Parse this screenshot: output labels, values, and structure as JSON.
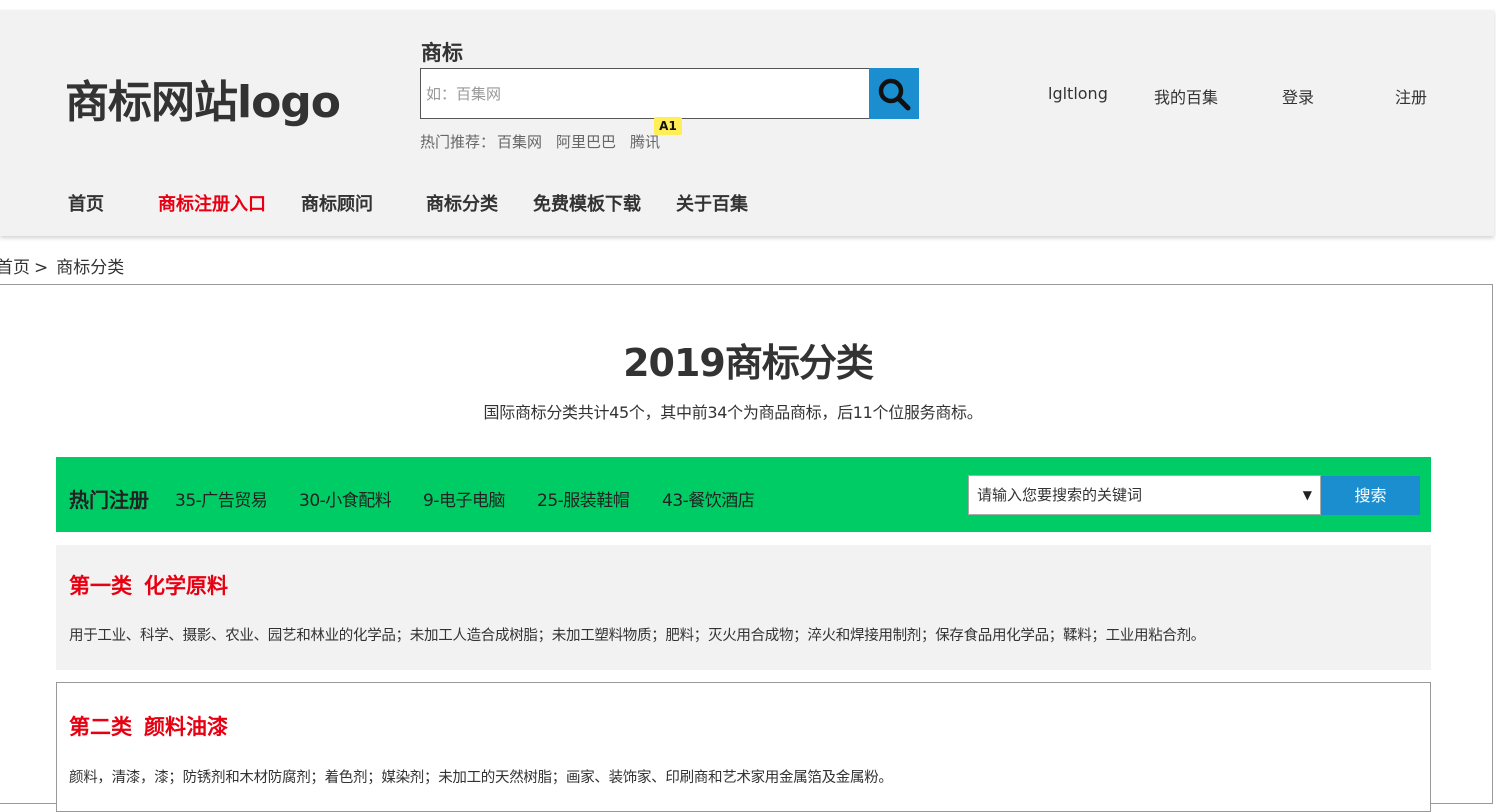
{
  "header": {
    "logo": "商标网站logo",
    "search_label": "商标",
    "search_placeholder": "如：百集网",
    "hot_prefix": "热门推荐：",
    "hot_items": [
      "百集网",
      "阿里巴巴",
      "腾讯"
    ],
    "badge": "A1",
    "user_links": [
      "lgltlong",
      "我的百集",
      "登录",
      "注册"
    ],
    "nav": [
      "首页",
      "商标注册入口",
      "商标顾问",
      "商标分类",
      "免费模板下载",
      "关于百集"
    ],
    "nav_active_index": 1
  },
  "breadcrumb": {
    "home": "首页",
    "separator": ">",
    "current": "商标分类"
  },
  "main": {
    "title": "2019商标分类",
    "subtitle": "国际商标分类共计45个，其中前34个为商品商标，后11个位服务商标。",
    "hot_bar": {
      "title": "热门注册",
      "items": [
        "35-广告贸易",
        "30-小食配料",
        "9-电子电脑",
        "25-服装鞋帽",
        "43-餐饮酒店"
      ],
      "select_value": "请输入您要搜索的关键词",
      "search_button": "搜索"
    },
    "categories": [
      {
        "num": "第一类",
        "name": "化学原料",
        "desc": "用于工业、科学、摄影、农业、园艺和林业的化学品；未加工人造合成树脂；未加工塑料物质；肥料；灭火用合成物；淬火和焊接用制剂；保存食品用化学品；鞣料；工业用粘合剂。"
      },
      {
        "num": "第二类",
        "name": "颜料油漆",
        "desc": "颜料，清漆，漆；防锈剂和木材防腐剂；着色剂；媒染剂；未加工的天然树脂；画家、装饰家、印刷商和艺术家用金属箔及金属粉。"
      }
    ]
  },
  "colors": {
    "accent_red": "#e60012",
    "accent_blue": "#1a8ecf",
    "hot_bar_green": "#00cc66",
    "header_bg": "#f2f2f2"
  }
}
